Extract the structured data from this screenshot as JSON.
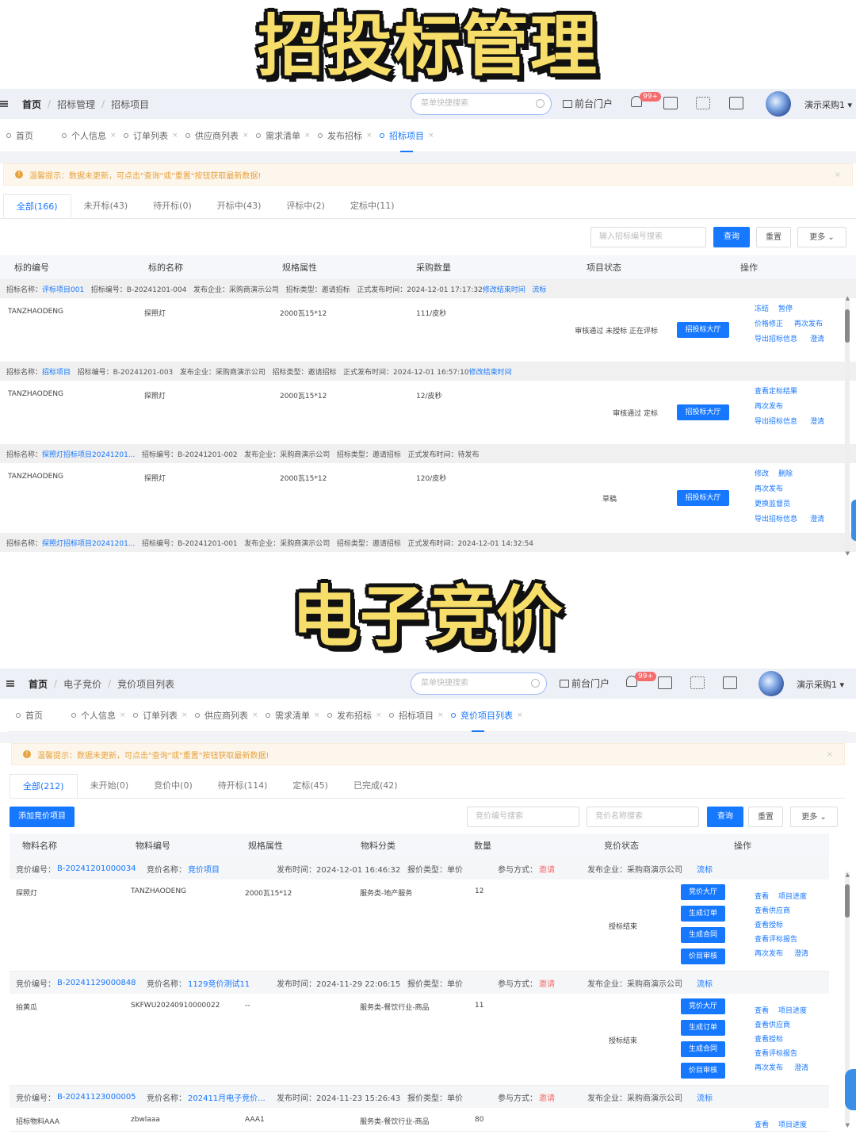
{
  "headings": {
    "top": "招投标管理",
    "bottom": "电子竞价"
  },
  "common": {
    "search_placeholder": "菜单快捷搜索",
    "portal": "前台门户",
    "badge": "99+",
    "user": "演示采购1 ▾",
    "alert": "温馨提示：数据未更新，可点击\"查询\"或\"重置\"按钮获取最新数据!",
    "alert_icon": "!",
    "close": "×",
    "tab_close": "×"
  },
  "bidding": {
    "breadcrumb": [
      "首页",
      "招标管理",
      "招标项目"
    ],
    "tabs": [
      "首页",
      "个人信息",
      "订单列表",
      "供应商列表",
      "需求清单",
      "发布招标",
      "招标项目"
    ],
    "status_tabs": [
      "全部(166)",
      "未开标(43)",
      "待开标(0)",
      "开标中(43)",
      "评标中(2)",
      "定标中(11)"
    ],
    "filter_placeholder": "输入招标编号搜索",
    "query": "查询",
    "reset": "重置",
    "more": "更多",
    "columns": [
      "标的编号",
      "标的名称",
      "规格属性",
      "采购数量",
      "项目状态",
      "操作"
    ],
    "hall": "招投标大厅",
    "projects": [
      {
        "info": [
          "招标名称：",
          "评标项目001",
          "招标编号：B-20241201-004",
          "发布企业：采购商演示公司",
          "招标类型：邀请招标",
          "正式发布时间：2024-12-01 17:17:32",
          "修改结束时间",
          "流标"
        ],
        "code": "TANZHAODENG",
        "name": "探照灯",
        "spec": "2000瓦15*12",
        "qty": "111/皮秒",
        "status": "审核通过  未授标  正在评标",
        "ops": [
          [
            "冻结",
            "暂停"
          ],
          [
            "价格修正",
            "再次发布"
          ],
          [
            "导出招标信息",
            "澄清"
          ]
        ]
      },
      {
        "info": [
          "招标名称：",
          "招标项目",
          "招标编号：B-20241201-003",
          "发布企业：采购商演示公司",
          "招标类型：邀请招标",
          "正式发布时间：2024-12-01 16:57:10",
          "修改结束时间",
          ""
        ],
        "code": "TANZHAODENG",
        "name": "探照灯",
        "spec": "2000瓦15*12",
        "qty": "12/皮秒",
        "status": "审核通过  定标",
        "ops": [
          [
            "查看定标结果"
          ],
          [
            "再次发布"
          ],
          [
            "导出招标信息",
            "澄清"
          ]
        ]
      },
      {
        "info": [
          "招标名称：",
          "探照灯招标项目20241201...",
          "招标编号：B-20241201-002",
          "发布企业：采购商演示公司",
          "招标类型：邀请招标",
          "正式发布时间：待发布",
          "",
          ""
        ],
        "code": "TANZHAODENG",
        "name": "探照灯",
        "spec": "2000瓦15*12",
        "qty": "120/皮秒",
        "status": "草稿",
        "ops": [
          [
            "修改",
            "删除"
          ],
          [
            "再次发布"
          ],
          [
            "更换监督员"
          ],
          [
            "导出招标信息",
            "澄清"
          ]
        ]
      },
      {
        "info": [
          "招标名称：",
          "探照灯招标项目20241201...",
          "招标编号：B-20241201-001",
          "发布企业：采购商演示公司",
          "招标类型：邀请招标",
          "正式发布时间：2024-12-01 14:32:54",
          "",
          ""
        ]
      }
    ]
  },
  "auction": {
    "breadcrumb": [
      "首页",
      "电子竞价",
      "竞价项目列表"
    ],
    "tabs": [
      "首页",
      "个人信息",
      "订单列表",
      "供应商列表",
      "需求清单",
      "发布招标",
      "招标项目",
      "竞价项目列表"
    ],
    "status_tabs": [
      "全部(212)",
      "未开始(0)",
      "竞价中(0)",
      "待开标(114)",
      "定标(45)",
      "已完成(42)"
    ],
    "add": "添加竞价项目",
    "ph1": "竞价编号搜索",
    "ph2": "竞价名称搜索",
    "query": "查询",
    "reset": "重置",
    "more": "更多",
    "columns": [
      "物料名称",
      "物料编号",
      "规格属性",
      "物料分类",
      "数量",
      "竞价状态",
      "操作"
    ],
    "btns": [
      "竞价大厅",
      "生成订单",
      "生成合同",
      "价目审核"
    ],
    "items": [
      {
        "info": {
          "no_label": "竞价编号：",
          "no": "B-20241201000034",
          "name_label": "竞价名称：",
          "name": "竞价项目",
          "time": "发布时间：2024-12-01 16:46:32",
          "type": "报价类型：单价",
          "way": "参与方式：",
          "way_v": "邀请",
          "ent": "发布企业：采购商演示公司",
          "flow": "流标"
        },
        "mat": "探照灯",
        "code": "TANZHAODENG",
        "spec": "2000瓦15*12",
        "cat": "服务类-地产服务",
        "qty": "12",
        "status": "授标结束",
        "ops": [
          [
            "查看",
            "项目进度"
          ],
          [
            "查看供应商"
          ],
          [
            "查看授标"
          ],
          [
            "查看评标报告"
          ],
          [
            "再次发布",
            "澄清"
          ]
        ]
      },
      {
        "info": {
          "no_label": "竞价编号：",
          "no": "B-20241129000848",
          "name_label": "竞价名称：",
          "name": "1129竞价测试11",
          "time": "发布时间：2024-11-29 22:06:15",
          "type": "报价类型：单价",
          "way": "参与方式：",
          "way_v": "邀请",
          "ent": "发布企业：采购商演示公司",
          "flow": "流标"
        },
        "mat": "拍黄瓜",
        "code": "SKFWU20240910000022",
        "spec": "--",
        "cat": "服务类-餐饮行业-商品",
        "qty": "11",
        "status": "授标结束",
        "ops": [
          [
            "查看",
            "项目进度"
          ],
          [
            "查看供应商"
          ],
          [
            "查看授标"
          ],
          [
            "查看评标报告"
          ],
          [
            "再次发布",
            "澄清"
          ]
        ]
      },
      {
        "info": {
          "no_label": "竞价编号：",
          "no": "B-20241123000005",
          "name_label": "竞价名称：",
          "name": "202411月电子竞价...",
          "time": "发布时间：2024-11-23 15:26:43",
          "type": "报价类型：单价",
          "way": "参与方式：",
          "way_v": "邀请",
          "ent": "发布企业：采购商演示公司",
          "flow": "流标"
        },
        "mat": "招标物料AAA",
        "code": "zbwlaaa",
        "spec": "AAA1",
        "cat": "服务类-餐饮行业-商品",
        "qty": "80",
        "status": "",
        "ops": [
          [
            "查看",
            "项目进度"
          ]
        ]
      }
    ]
  }
}
